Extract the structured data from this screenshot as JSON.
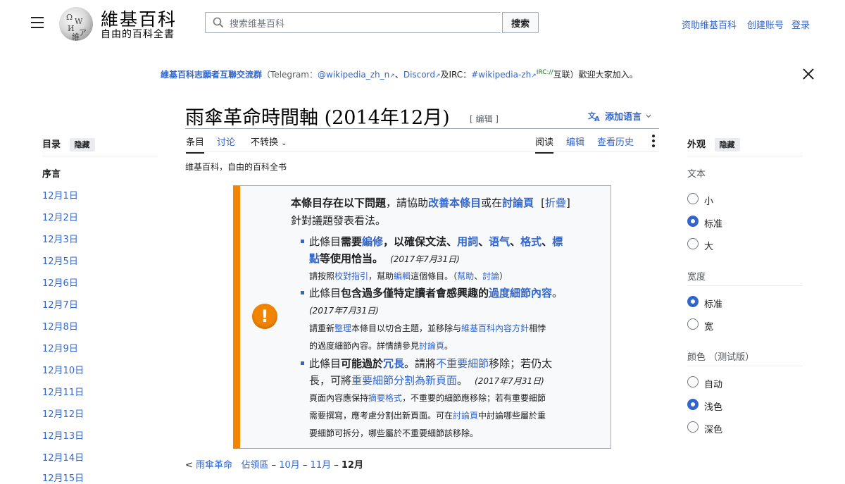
{
  "header": {
    "site_title": "維基百科",
    "site_tagline": "自由的百科全書",
    "search_placeholder": "搜索维基百科",
    "search_button": "搜索",
    "donate": "资助维基百科",
    "create_account": "创建账号",
    "login": "登录",
    "logo_letters": [
      "Ω",
      "W",
      "И",
      "ア",
      "維"
    ]
  },
  "banner": {
    "part1": "維基百科志願者互聯交流群",
    "part2": "（Telegram：",
    "telegram": "@wikipedia_zh_n",
    "part3": "、",
    "discord": "Discord",
    "part4": "及IRC：",
    "irc": "#wikipedia-zh",
    "irc_sup": "IRC://",
    "part5": "互联）歡迎大家加入。"
  },
  "page": {
    "title": "雨傘革命時間軸 (2014年12月)",
    "edit_link": "[ 编辑 ]",
    "add_language": "添加语言",
    "subtitle": "维基百科，自由的百科全书"
  },
  "tabs": {
    "article": "条目",
    "talk": "讨论",
    "variant": "不转换",
    "read": "阅读",
    "edit": "编辑",
    "history": "查看历史"
  },
  "toc": {
    "title": "目录",
    "hide": "隐藏",
    "items": [
      "序言",
      "12月1日",
      "12月2日",
      "12月3日",
      "12月5日",
      "12月6日",
      "12月7日",
      "12月8日",
      "12月9日",
      "12月10日",
      "12月11日",
      "12月12日",
      "12月13日",
      "12月14日",
      "12月15日"
    ]
  },
  "notice": {
    "head_a": "本條目存在以下問題",
    "head_b": "，請協助",
    "head_link1": "改善本條目",
    "head_c": "或在",
    "head_link2": "討論頁",
    "head_d": "[",
    "head_collapse": "折疊",
    "head_e": "]",
    "head_line2": "針對議題發表看法。",
    "i1_a": "此條目",
    "i1_b": "需要",
    "i1_link": "編修",
    "i1_c": "，以確保文法、",
    "i1_l2": "用詞",
    "i1_d": "、",
    "i1_l3": "语气",
    "i1_e": "、",
    "i1_l4": "格式",
    "i1_f": "、",
    "i1_l5a": "標",
    "i1_l5b": "點",
    "i1_g": "等使用恰当。",
    "i1_date": "(2017年7月31日)",
    "i1_note_a": "請按照",
    "i1_note_l1": "校對指引",
    "i1_note_b": "，幫助",
    "i1_note_l2": "編輯",
    "i1_note_c": "這個條目。（",
    "i1_note_l3": "幫助",
    "i1_note_d": "、",
    "i1_note_l4": "討論",
    "i1_note_e": "）",
    "i2_a": "此條目",
    "i2_b": "包含過多僅特定讀者會感興趣的",
    "i2_link": "過度細節內容",
    "i2_c": "。",
    "i2_date": "(2017年7月31日)",
    "i2_note1_a": "請重新",
    "i2_note1_l1": "整理",
    "i2_note1_b": "本條目以切合主題，並移除与",
    "i2_note1_l2": "維基百科內容方針",
    "i2_note1_c": "相悖",
    "i2_note2_a": "的過度細節內容。詳情請參見",
    "i2_note2_l": "討論頁",
    "i2_note2_b": "。",
    "i3_a": "此條目",
    "i3_b": "可能過於",
    "i3_link1": "冗長",
    "i3_c": "。請將",
    "i3_link2": "不重要細節",
    "i3_d": "移除；若仍太",
    "i3_line2_a": "長，可將",
    "i3_line2_link": "重要細節分割為新頁面",
    "i3_line2_b": "。",
    "i3_date": "(2017年7月31日)",
    "i3_note1_a": "頁面內容應保持",
    "i3_note1_l": "摘要格式",
    "i3_note1_b": "，不重要的細節應移除；若有重要細節",
    "i3_note2_a": "需要撰寫，應考慮分割出新頁面。可在",
    "i3_note2_l": "討論頁",
    "i3_note2_b": "中討論哪些屬於重",
    "i3_note3": "要細節可拆分，哪些屬於不重要細節該移除。"
  },
  "appearance": {
    "title": "外观",
    "hide": "隐藏",
    "text_label": "文本",
    "text_options": [
      "小",
      "标准",
      "大"
    ],
    "text_selected": 1,
    "width_label": "宽度",
    "width_options": [
      "标准",
      "宽"
    ],
    "width_selected": 0,
    "color_label": "颜色 （测试版）",
    "color_options": [
      "自动",
      "浅色",
      "深色"
    ],
    "color_selected": 1
  },
  "bottom_nav": {
    "prefix": "< ",
    "l1": "雨傘革命",
    "l2": "佔領區",
    "sep": " – ",
    "l3": "10月",
    "l4": "11月",
    "current": "12月"
  }
}
